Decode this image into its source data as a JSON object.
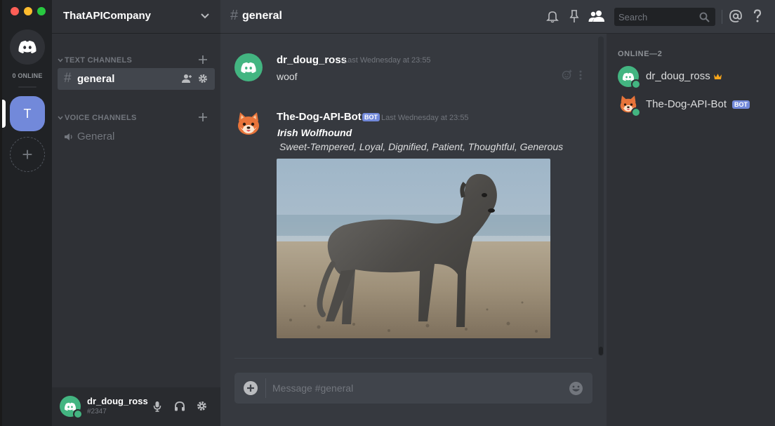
{
  "window": {
    "controls": [
      {
        "name": "close",
        "color": "#ff5f57"
      },
      {
        "name": "minimize",
        "color": "#febc2e"
      },
      {
        "name": "zoom",
        "color": "#28c840"
      }
    ]
  },
  "servers": {
    "online_label": "0 ONLINE",
    "items": [
      {
        "initial": "T",
        "active": true
      }
    ],
    "add_icon": "+"
  },
  "sidebar": {
    "server_name": "ThatAPICompany",
    "categories": [
      {
        "label": "TEXT CHANNELS",
        "channels": [
          {
            "name": "general",
            "active": true
          }
        ]
      },
      {
        "label": "VOICE CHANNELS",
        "channels": [
          {
            "name": "General",
            "active": false
          }
        ]
      }
    ]
  },
  "user_panel": {
    "username": "dr_doug_ross",
    "discriminator": "#2347"
  },
  "header": {
    "channel_name": "general",
    "search_placeholder": "Search"
  },
  "messages": [
    {
      "author": "dr_doug_ross",
      "timestamp": "Last Wednesday at 23:55",
      "text": "woof",
      "bot": false
    },
    {
      "author": "The-Dog-API-Bot",
      "bot_tag": "BOT",
      "timestamp": "Last Wednesday at 23:55",
      "embed": {
        "title": "Irish Wolfhound",
        "description": "Sweet-Tempered, Loyal, Dignified, Patient, Thoughtful, Generous"
      }
    }
  ],
  "composer": {
    "placeholder": "Message #general"
  },
  "members": {
    "category": "ONLINE—2",
    "list": [
      {
        "name": "dr_doug_ross",
        "owner": true
      },
      {
        "name": "The-Dog-API-Bot",
        "bot_tag": "BOT"
      }
    ]
  },
  "colors": {
    "blurple": "#7289da",
    "online": "#43b581",
    "owner_crown": "#faa61a"
  }
}
